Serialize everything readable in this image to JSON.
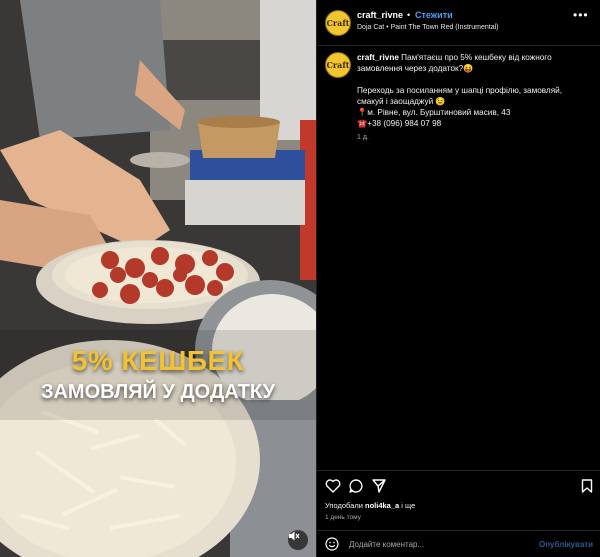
{
  "overlay": {
    "caption_top": "5% КЕШБЕК",
    "caption_bottom": "ЗАМОВЛЯЙ У ДОДАТКУ"
  },
  "header": {
    "avatar_text": "Craft",
    "username": "craft_rivne",
    "separator": "•",
    "follow_label": "Стежити",
    "music": "Doja Cat • Paint The Town Red (Instrumental)",
    "more_label": "•••"
  },
  "post": {
    "avatar_text": "Craft",
    "username": "craft_rivne",
    "line1": "Пам'ятаєш про 5% кешбеку від кожного",
    "line2": "замовлення через додаток?😝",
    "line3": "Переходь за посиланням у шапці профілю, замовляй,",
    "line4": "смакуй і заощаджуй 😉",
    "line5": "📍м. Рівне, вул. Бурштиновий масив, 43",
    "line6": "☎️+38 (096) 984 07 98",
    "time": "1 д."
  },
  "likes": {
    "prefix": "Уподобали ",
    "user": "noli4ka_a",
    "suffix": " і ще"
  },
  "ago": "1 день тому",
  "comment": {
    "placeholder": "Додайте коментар...",
    "publish_label": "Опублікувати"
  },
  "icons": [
    "heart-icon",
    "comment-icon",
    "share-icon",
    "bookmark-icon",
    "emoji-icon",
    "mute-icon",
    "more-icon"
  ],
  "colors": {
    "follow": "#4a9cf5",
    "publish": "#2b5a8d",
    "caption_yellow": "#f2c230",
    "avatar": "#f3c532"
  }
}
